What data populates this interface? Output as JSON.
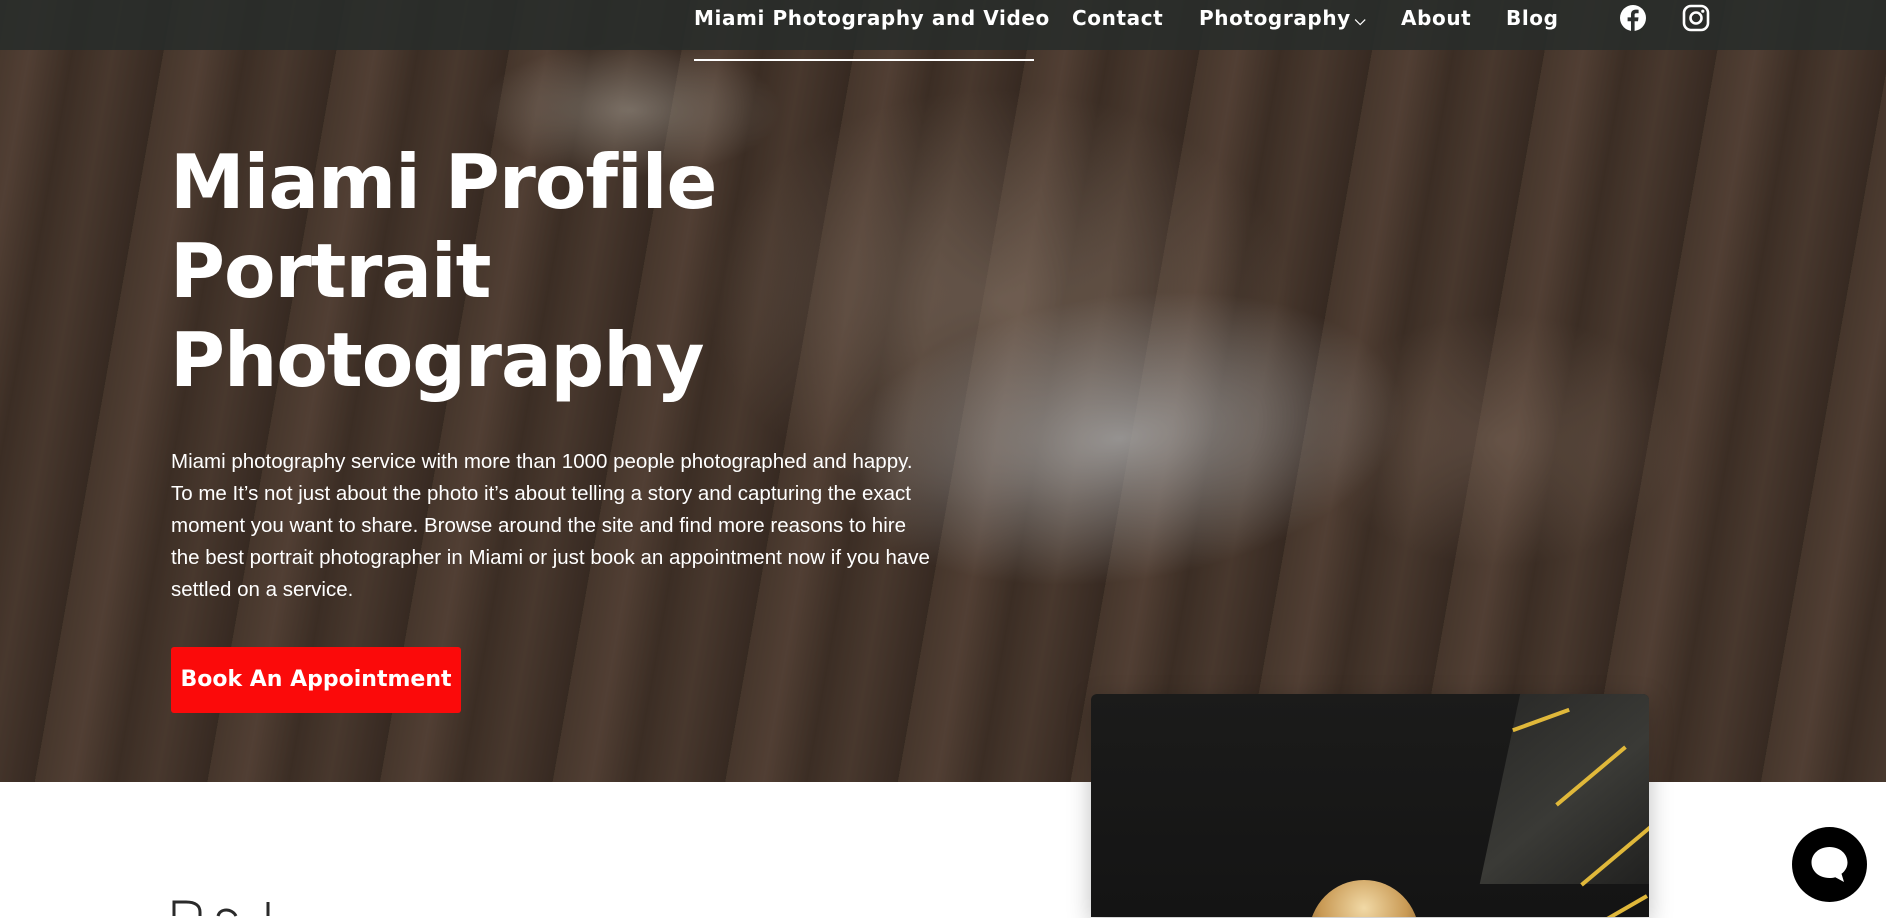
{
  "nav": {
    "items": [
      {
        "label": "Miami Photography and Video"
      },
      {
        "label": "Contact"
      },
      {
        "label": "Photography",
        "dropdown": true
      },
      {
        "label": "About"
      },
      {
        "label": "Blog"
      }
    ],
    "dropdown_icon": "chevron-down-icon",
    "social": [
      {
        "icon": "facebook-icon"
      },
      {
        "icon": "instagram-icon"
      }
    ]
  },
  "hero": {
    "title_lines": [
      "Miami Profile",
      "Portrait",
      "Photography"
    ],
    "description": "Miami photography service with more than 1000 people photographed and happy. To me It’s not just about the photo it’s about telling a story and capturing the exact moment you want to share. Browse around the site and find more reasons to hire the best portrait photographer in Miami or just book an appointment now if you have settled on a service.",
    "cta_label": "Book An Appointment"
  },
  "colors": {
    "cta_background": "#fb0a0a",
    "nav_background": "#2c2f2e",
    "chat_button": "#000000"
  },
  "chat": {
    "icon": "chat-bubble-icon"
  }
}
